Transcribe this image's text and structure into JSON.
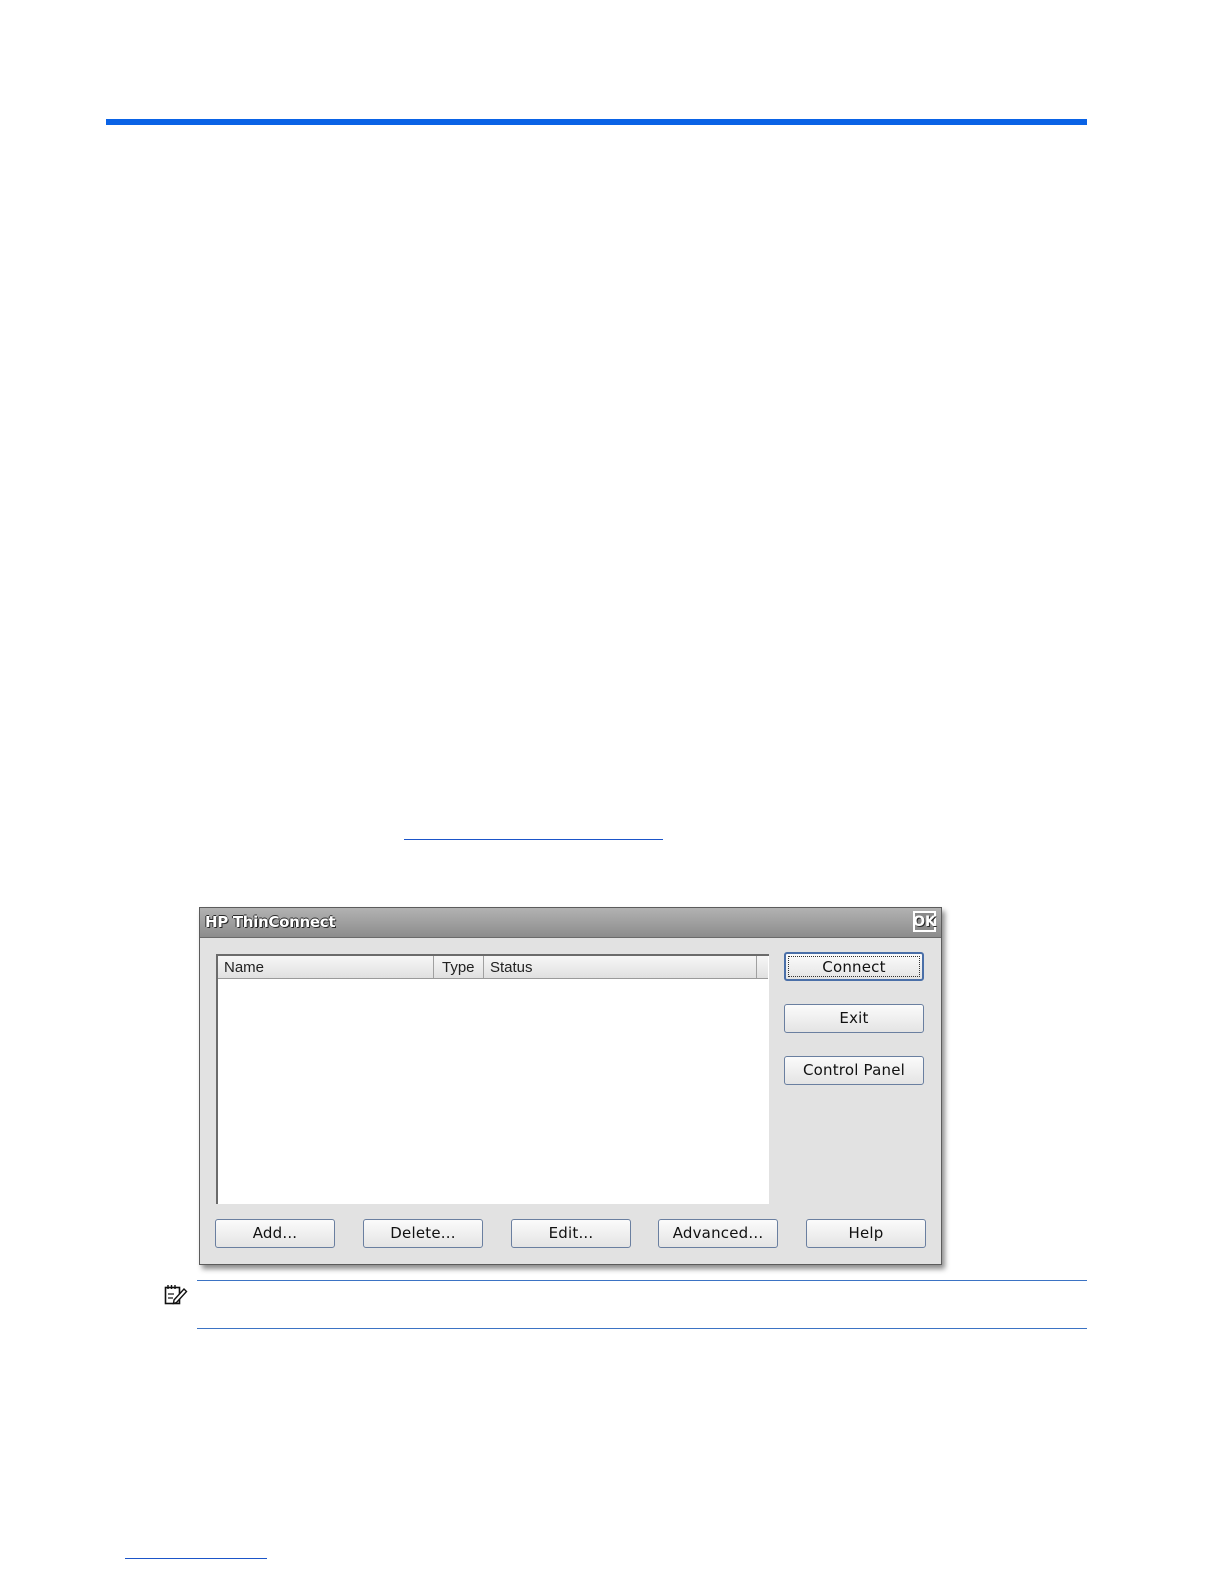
{
  "dialog": {
    "title": "HP ThinConnect",
    "ok_label": "OK",
    "columns": [
      "Name",
      "Type",
      "Status"
    ],
    "side_buttons": {
      "connect": "Connect",
      "exit": "Exit",
      "control_panel": "Control Panel"
    },
    "bottom_buttons": {
      "add": "Add...",
      "delete": "Delete...",
      "edit": "Edit...",
      "advanced": "Advanced...",
      "help": "Help"
    }
  },
  "colors": {
    "header_rule": "#0a63e6",
    "note_rule": "#3b73c4"
  },
  "icons": {
    "note": "note-pencil-icon"
  }
}
